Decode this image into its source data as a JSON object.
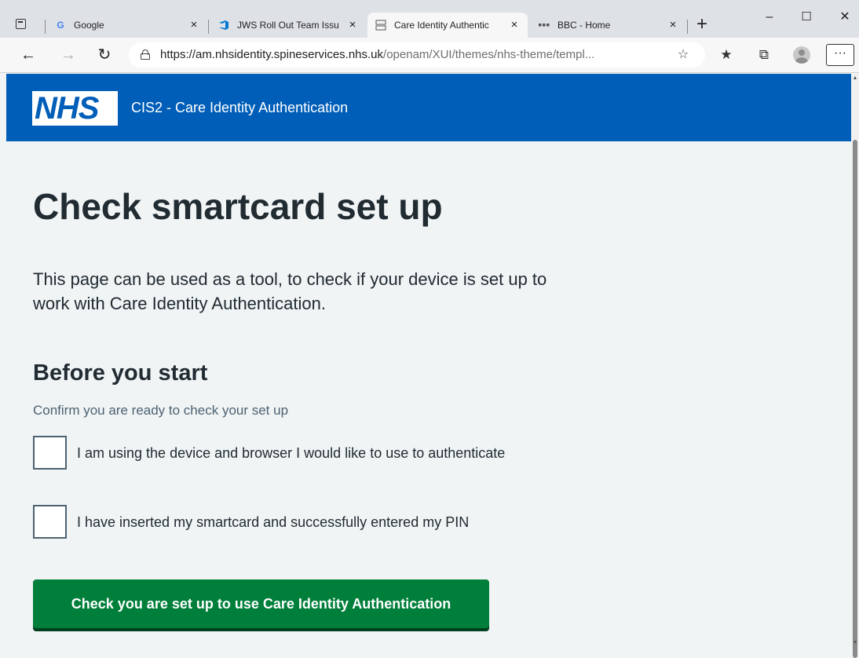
{
  "browser": {
    "tabs": [
      {
        "title": "Google",
        "favicon": "G",
        "active": false
      },
      {
        "title": "JWS Roll Out Team Issu",
        "favicon": "azure-devops-icon",
        "active": false
      },
      {
        "title": "Care Identity Authentic",
        "favicon": "cis2-icon",
        "active": true
      },
      {
        "title": "BBC - Home",
        "favicon": "bbc-icon",
        "active": false
      }
    ],
    "url_domain": "https://am.nhsidentity.spineservices.nhs.uk",
    "url_path": "/openam/XUI/themes/nhs-theme/templ...",
    "icons": {
      "tab_actions": "▣",
      "back": "←",
      "forward": "→",
      "refresh": "↻",
      "favorite_add": "☆",
      "favorites": "★",
      "collections": "⧉",
      "more": "···",
      "new_tab": "+",
      "minimize": "–",
      "maximize": "☐",
      "close": "✕",
      "tab_close": "×"
    }
  },
  "header": {
    "logo_text": "NHS",
    "service_name": "CIS2 - Care Identity Authentication"
  },
  "main": {
    "title": "Check smartcard set up",
    "lede": "This page can be used as a tool, to check if your device is set up to work with Care Identity Authentication.",
    "section_title": "Before you start",
    "hint": "Confirm you are ready to check your set up",
    "checkboxes": [
      {
        "label": "I am using the device and browser I would like to use to authenticate",
        "checked": false
      },
      {
        "label": "I have inserted my smartcard and successfully entered my PIN",
        "checked": false
      }
    ],
    "button_label": "Check you are set up to use Care Identity Authentication"
  },
  "colors": {
    "nhs_blue": "#005eb8",
    "nhs_green": "#007f3b",
    "text": "#212b32",
    "secondary_text": "#4c6272",
    "page_bg": "#f0f4f5"
  }
}
